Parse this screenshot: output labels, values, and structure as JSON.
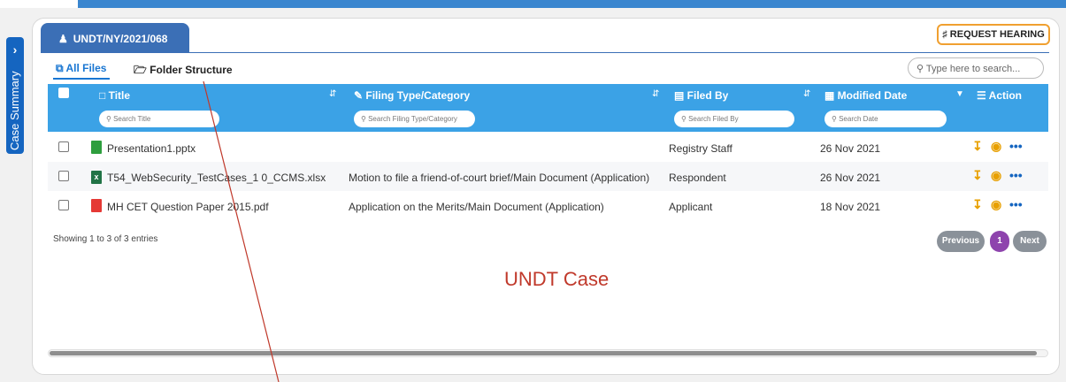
{
  "side": {
    "label": "Case Summary",
    "chevron": "chevron-right-icon"
  },
  "case_tab": {
    "label": "UNDT/NY/2021/068",
    "icon": "user-icon"
  },
  "request_button": {
    "label": "REQUEST HEARING",
    "icon": "ear-icon"
  },
  "tabs": {
    "all_files": "All Files",
    "folder_structure": "Folder Structure"
  },
  "search": {
    "placeholder": "Type here to search..."
  },
  "columns": {
    "title": "Title",
    "filing_type": "Filing Type/Category",
    "filed_by": "Filed By",
    "modified_date": "Modified Date",
    "action": "Action"
  },
  "filters": {
    "title": "Search Title",
    "filing_type": "Search Filing Type/Category",
    "filed_by": "Search Filed By",
    "date": "Search Date"
  },
  "rows": [
    {
      "file": "Presentation1.pptx",
      "filing_type": "",
      "filed_by": "Registry Staff",
      "date": "26 Nov 2021",
      "file_icon": "pptx-file-icon"
    },
    {
      "file": "T54_WebSecurity_TestCases_1 0_CCMS.xlsx",
      "filing_type": "Motion to file a friend-of-court brief/Main Document (Application)",
      "filed_by": "Respondent",
      "date": "26 Nov 2021",
      "file_icon": "excel-file-icon"
    },
    {
      "file": "MH CET Question Paper 2015.pdf",
      "filing_type": "Application on the Merits/Main Document (Application)",
      "filed_by": "Applicant",
      "date": "18 Nov 2021",
      "file_icon": "pdf-file-icon"
    }
  ],
  "footer": {
    "showing": "Showing 1 to 3 of 3 entries"
  },
  "pagination": {
    "previous": "Previous",
    "page": "1",
    "next": "Next"
  },
  "caption": "UNDT Case",
  "colors": {
    "header": "#3ba2e6",
    "case_tab": "#3b6fb6",
    "accent": "#e8a000",
    "caption": "#c0392b",
    "active_page": "#8e44ad"
  }
}
